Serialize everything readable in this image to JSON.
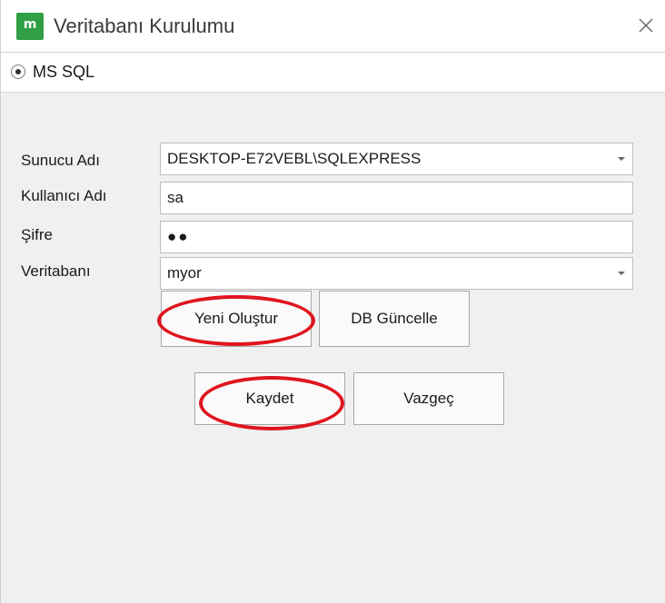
{
  "window": {
    "title": "Veritabanı Kurulumu",
    "logo_text": "m",
    "accent_color": "#2f9e44",
    "highlight_color": "#e0141e"
  },
  "provider": {
    "label": "MS SQL",
    "selected": true
  },
  "form": {
    "server": {
      "label": "Sunucu Adı",
      "value": "DESKTOP-E72VEBL\\SQLEXPRESS"
    },
    "username": {
      "label": "Kullanıcı Adı",
      "value": "sa"
    },
    "password": {
      "label": "Şifre",
      "masked_value": "●●"
    },
    "database": {
      "label": "Veritabanı",
      "value": "myor"
    }
  },
  "buttons": {
    "create_new": "Yeni Oluştur",
    "db_update": "DB Güncelle",
    "save": "Kaydet",
    "cancel": "Vazgeç"
  }
}
